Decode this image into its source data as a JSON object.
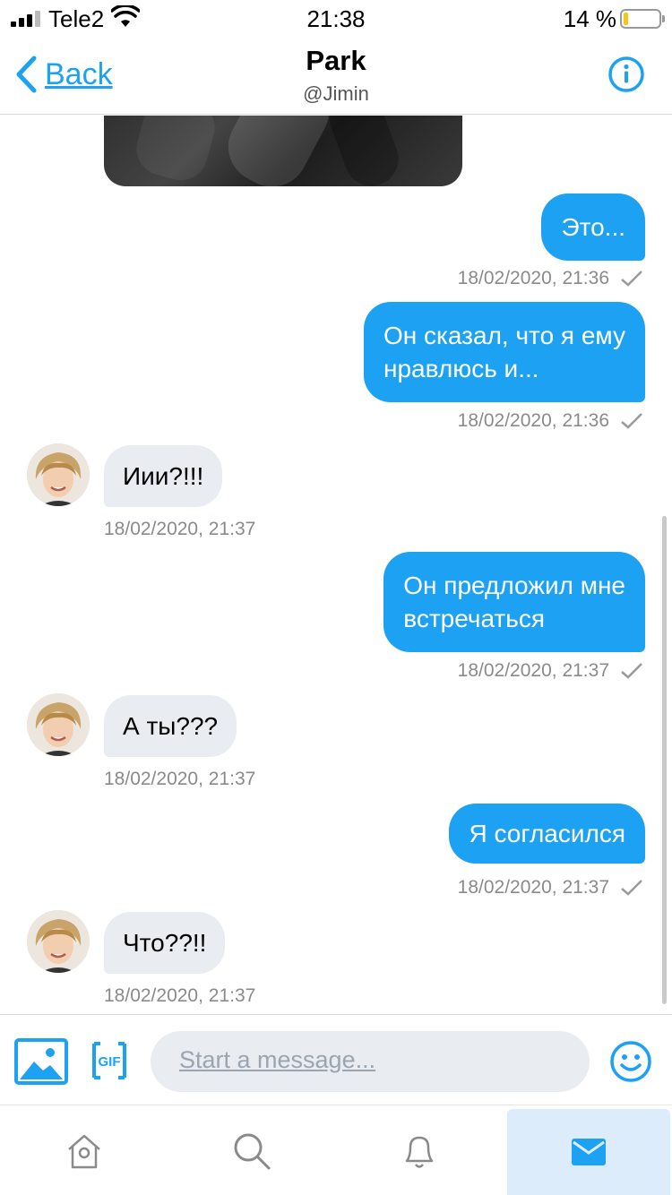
{
  "status_bar": {
    "carrier": "Tele2",
    "time": "21:38",
    "battery_percent": "14 %",
    "battery_level": 0.14
  },
  "header": {
    "back_label": "Back",
    "title": "Park",
    "handle": "@Jimin"
  },
  "colors": {
    "accent": "#1da1f2",
    "incoming_bubble": "#e9ecf0",
    "timestamp": "#8a8a8a"
  },
  "messages": [
    {
      "direction": "out",
      "text": "Это...",
      "time": "18/02/2020, 21:36"
    },
    {
      "direction": "out",
      "lines": [
        "Он сказал, что я ему",
        "нравлюсь и..."
      ],
      "time": "18/02/2020, 21:36"
    },
    {
      "direction": "in",
      "text": "Иии?!!!",
      "time": "18/02/2020, 21:37"
    },
    {
      "direction": "out",
      "lines": [
        "Он предложил мне",
        "встречаться"
      ],
      "time": "18/02/2020, 21:37"
    },
    {
      "direction": "in",
      "text": "А ты???",
      "time": "18/02/2020, 21:37"
    },
    {
      "direction": "out",
      "text": "Я согласился",
      "time": "18/02/2020, 21:37"
    },
    {
      "direction": "in",
      "text": "Что??!!",
      "time": "18/02/2020, 21:37"
    }
  ],
  "composer": {
    "placeholder": "Start a message...",
    "value": "",
    "image_icon": "image-icon",
    "gif_label": "GIF",
    "emoji_icon": "emoji-icon"
  },
  "tabbar": {
    "tabs": [
      {
        "icon": "home-icon",
        "active": false
      },
      {
        "icon": "search-icon",
        "active": false
      },
      {
        "icon": "bell-icon",
        "active": false
      },
      {
        "icon": "mail-icon",
        "active": true
      }
    ]
  }
}
